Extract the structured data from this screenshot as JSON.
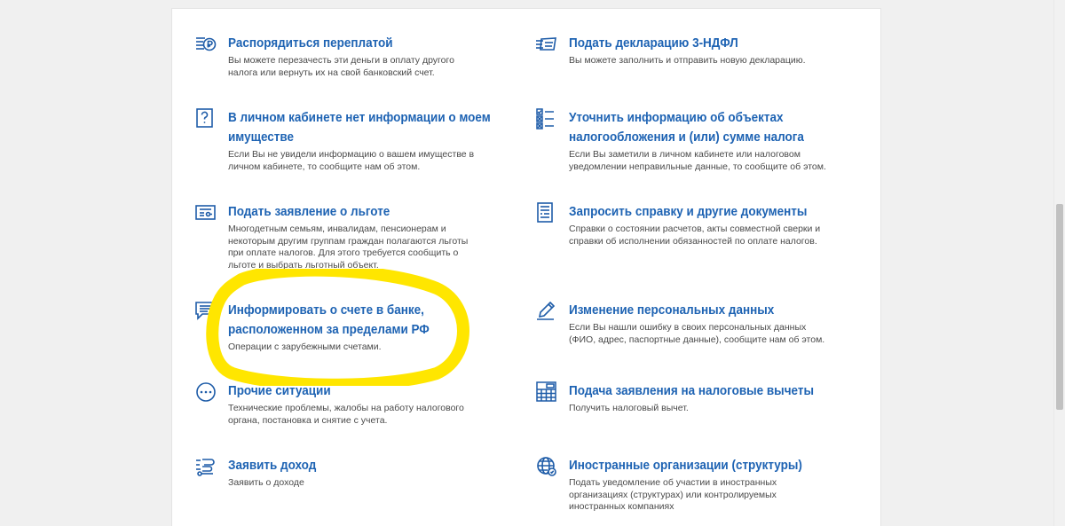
{
  "items": [
    {
      "title": "Распорядиться переплатой",
      "desc": "Вы можете перезачесть эти деньги в оплату другого налога или вернуть их на свой банковский счет.",
      "icon": "overpayment-icon"
    },
    {
      "title": "Подать декларацию 3-НДФЛ",
      "desc": "Вы можете заполнить и отправить новую декларацию.",
      "icon": "declaration-icon"
    },
    {
      "title_line1": "В личном кабинете нет информации о моем",
      "title_line2": "имуществе",
      "desc": "Если Вы не увидели информацию о вашем имуществе в личном кабинете, то сообщите нам об этом.",
      "icon": "question-icon"
    },
    {
      "title_line1": "Уточнить информацию об объектах",
      "title_line2": "налогообложения и (или) сумме налога",
      "desc": "Если Вы заметили в личном кабинете или налоговом уведомлении неправильные данные, то сообщите об этом.",
      "icon": "checklist-icon"
    },
    {
      "title": "Подать заявление о льготе",
      "desc": "Многодетным семьям, инвалидам, пенсионерам и некоторым другим группам граждан полагаются льготы при оплате налогов. Для этого требуется сообщить о льготе и выбрать льготный объект.",
      "icon": "benefit-icon"
    },
    {
      "title": "Запросить справку и другие документы",
      "desc": "Справки о состоянии расчетов, акты совместной сверки и справки об исполнении обязанностей по оплате налогов.",
      "icon": "document-icon"
    },
    {
      "title_line1": "Информировать о счете в банке,",
      "title_line2": "расположенном за пределами РФ",
      "desc": "Операции с зарубежными счетами.",
      "icon": "message-icon"
    },
    {
      "title": "Изменение персональных данных",
      "desc": "Если Вы нашли ошибку в своих персональных данных (ФИО, адрес, паспортные данные), сообщите нам об этом.",
      "icon": "pencil-icon"
    },
    {
      "title": "Прочие ситуации",
      "desc": "Технические проблемы, жалобы на работу налогового органа, постановка и снятие с учета.",
      "icon": "more-icon"
    },
    {
      "title": "Подача заявления на налоговые вычеты",
      "desc": "Получить налоговый вычет.",
      "icon": "calculator-icon"
    },
    {
      "title": "Заявить доход",
      "desc": "Заявить о доходе",
      "icon": "income-icon"
    },
    {
      "title": "Иностранные организации (структуры)",
      "desc": "Подать уведомление об участии в иностранных организациях (структурах) или контролируемых иностранных компаниях",
      "icon": "globe-icon"
    }
  ],
  "colors": {
    "title": "#1e63b3",
    "icon": "#1e5ca8",
    "desc": "#4a4a4a",
    "highlight": "#ffe600"
  }
}
